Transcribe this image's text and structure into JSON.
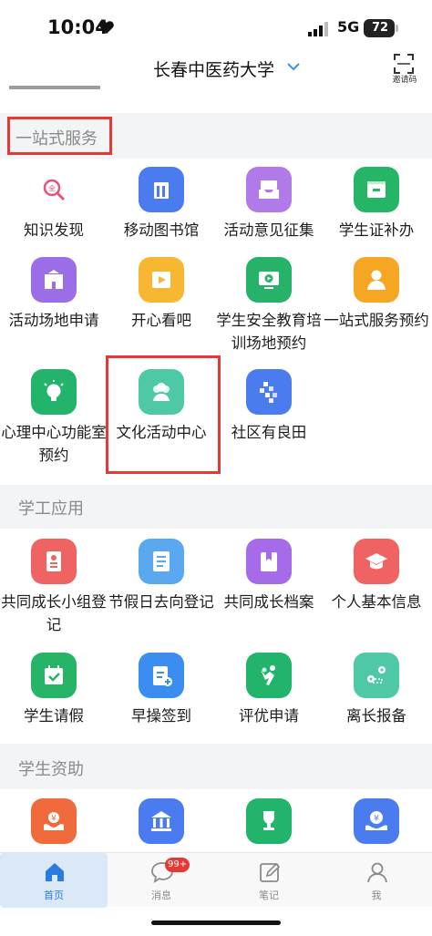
{
  "status_bar": {
    "time": "10:04",
    "network": "5G",
    "battery": "72"
  },
  "header": {
    "title": "长春中医药大学",
    "scan_label": "邀请码"
  },
  "colors": {
    "accent": "#2a7be0",
    "highlight": "#e53935",
    "section_bg": "#f3f4f6"
  },
  "sections": [
    {
      "title": "一站式服务",
      "items": [
        {
          "label": "知识发现",
          "icon": "knowledge-search-icon",
          "color": "#ffffff"
        },
        {
          "label": "移动图书馆",
          "icon": "library-building-icon",
          "color": "#4a7cf0"
        },
        {
          "label": "活动意见征集",
          "icon": "inbox-tray-icon",
          "color": "#b07be8"
        },
        {
          "label": "学生证补办",
          "icon": "id-card-icon",
          "color": "#26b567"
        },
        {
          "label": "活动场地申请",
          "icon": "school-building-icon",
          "color": "#9b6ee8"
        },
        {
          "label": "开心看吧",
          "icon": "video-play-icon",
          "color": "#f7b733"
        },
        {
          "label": "学生安全教育培训场地预约",
          "icon": "monitor-play-icon",
          "color": "#27b26a"
        },
        {
          "label": "一站式服务预约",
          "icon": "person-service-icon",
          "color": "#f5a623"
        },
        {
          "label": "心理中心功能室预约",
          "icon": "lightbulb-icon",
          "color": "#22b46a"
        },
        {
          "label": "文化活动中心",
          "icon": "group-people-icon",
          "color": "#4fc9a5"
        },
        {
          "label": "社区有良田",
          "icon": "field-grid-icon",
          "color": "#4a7cf0"
        }
      ]
    },
    {
      "title": "学工应用",
      "items": [
        {
          "label": "共同成长小组登记",
          "icon": "contact-book-icon",
          "color": "#f06363"
        },
        {
          "label": "节假日去向登记",
          "icon": "checklist-icon",
          "color": "#5aa9f0"
        },
        {
          "label": "共同成长档案",
          "icon": "archive-book-icon",
          "color": "#a56be8"
        },
        {
          "label": "个人基本信息",
          "icon": "graduation-cap-icon",
          "color": "#f06363"
        },
        {
          "label": "学生请假",
          "icon": "calendar-check-icon",
          "color": "#26b567"
        },
        {
          "label": "早操签到",
          "icon": "clipboard-plus-icon",
          "color": "#3b8ef0"
        },
        {
          "label": "评优申请",
          "icon": "people-cheer-icon",
          "color": "#22b46a"
        },
        {
          "label": "离长报备",
          "icon": "map-route-icon",
          "color": "#4fc9a5"
        }
      ]
    },
    {
      "title": "学生资助",
      "items": [
        {
          "label": "",
          "icon": "yuan-hands-icon",
          "color": "#f06a3c"
        },
        {
          "label": "",
          "icon": "bank-building-icon",
          "color": "#4a7cf0"
        },
        {
          "label": "",
          "icon": "trophy-icon",
          "color": "#22b46a"
        },
        {
          "label": "",
          "icon": "yuan-coin-hand-icon",
          "color": "#4a7cf0"
        }
      ]
    }
  ],
  "bottom_nav": [
    {
      "label": "首页",
      "icon": "home-icon",
      "active": true
    },
    {
      "label": "消息",
      "icon": "message-icon",
      "badge": "99+"
    },
    {
      "label": "笔记",
      "icon": "note-edit-icon"
    },
    {
      "label": "我",
      "icon": "profile-icon"
    }
  ]
}
